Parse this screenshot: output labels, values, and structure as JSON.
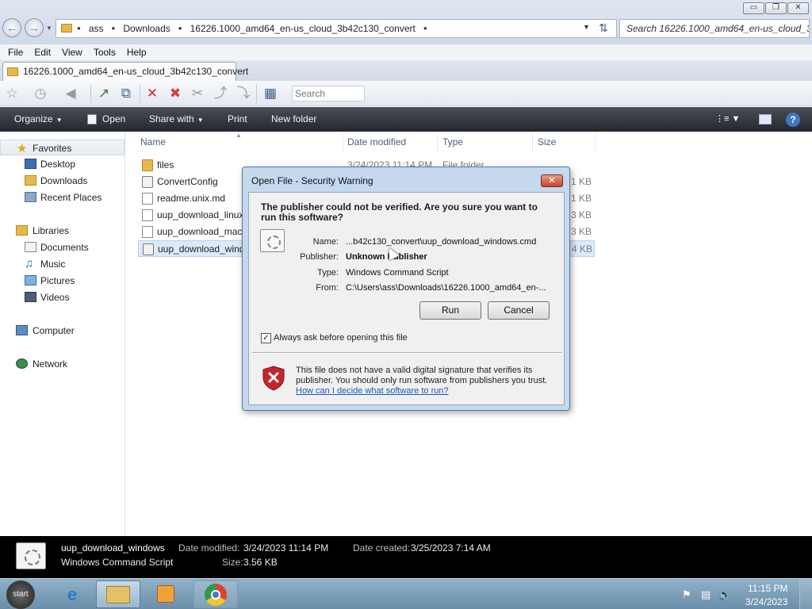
{
  "window": {
    "title_buttons": {
      "minimize": "▭",
      "maximize": "❐",
      "close": "✕"
    }
  },
  "address": {
    "path": [
      "ass",
      "Downloads",
      "16226.1000_amd64_en-us_cloud_3b42c130_convert"
    ],
    "search_placeholder": "Search 16226.1000_amd64_en-us_cloud_3b42c130_convert"
  },
  "menu": [
    "File",
    "Edit",
    "View",
    "Tools",
    "Help"
  ],
  "tab": {
    "label": "16226.1000_amd64_en-us_cloud_3b42c130_convert"
  },
  "toolbar": {
    "search_placeholder": "Search"
  },
  "commandbar": {
    "organize": "Organize",
    "open": "Open",
    "share_with": "Share with",
    "print": "Print",
    "new_folder": "New folder"
  },
  "nav": {
    "favorites": "Favorites",
    "desktop": "Desktop",
    "downloads": "Downloads",
    "recent_places": "Recent Places",
    "libraries": "Libraries",
    "documents": "Documents",
    "music": "Music",
    "pictures": "Pictures",
    "videos": "Videos",
    "computer": "Computer",
    "network": "Network"
  },
  "columns": {
    "name": "Name",
    "date_modified": "Date modified",
    "type": "Type",
    "size": "Size"
  },
  "files": [
    {
      "name": "files",
      "date": "3/24/2023 11:14 PM",
      "type": "File folder",
      "size": ""
    },
    {
      "name": "ConvertConfig",
      "date": "",
      "type": "",
      "size": "1 KB"
    },
    {
      "name": "readme.unix.md",
      "date": "",
      "type": "",
      "size": "1 KB"
    },
    {
      "name": "uup_download_linux",
      "date": "",
      "type": "",
      "size": "3 KB"
    },
    {
      "name": "uup_download_mac",
      "date": "",
      "type": "",
      "size": "3 KB"
    },
    {
      "name": "uup_download_wind",
      "date": "",
      "type": "",
      "size": "4 KB"
    }
  ],
  "dialog": {
    "title": "Open File - Security Warning",
    "close": "✕",
    "heading": "The publisher could not be verified.  Are you sure you want to run this software?",
    "fields": {
      "name_label": "Name:",
      "name_value": "...b42c130_convert\\uup_download_windows.cmd",
      "publisher_label": "Publisher:",
      "publisher_value": "Unknown Publisher",
      "type_label": "Type:",
      "type_value": "Windows Command Script",
      "from_label": "From:",
      "from_value": "C:\\Users\\ass\\Downloads\\16226.1000_amd64_en-..."
    },
    "run_button": "Run",
    "cancel_button": "Cancel",
    "checkbox_label": "Always ask before opening this file",
    "checkbox_checked": true,
    "warning_text": "This file does not have a valid digital signature that verifies its publisher.  You should only run software from publishers you trust.",
    "help_link": "How can I decide what software to run?"
  },
  "details": {
    "name": "uup_download_windows",
    "type": "Windows Command Script",
    "date_modified_label": "Date modified:",
    "date_modified": "3/24/2023 11:14 PM",
    "size_label": "Size:",
    "size": "3.56 KB",
    "date_created_label": "Date created:",
    "date_created": "3/25/2023 7:14 AM"
  },
  "taskbar": {
    "start": "start",
    "time": "11:15 PM",
    "date": "3/24/2023"
  }
}
